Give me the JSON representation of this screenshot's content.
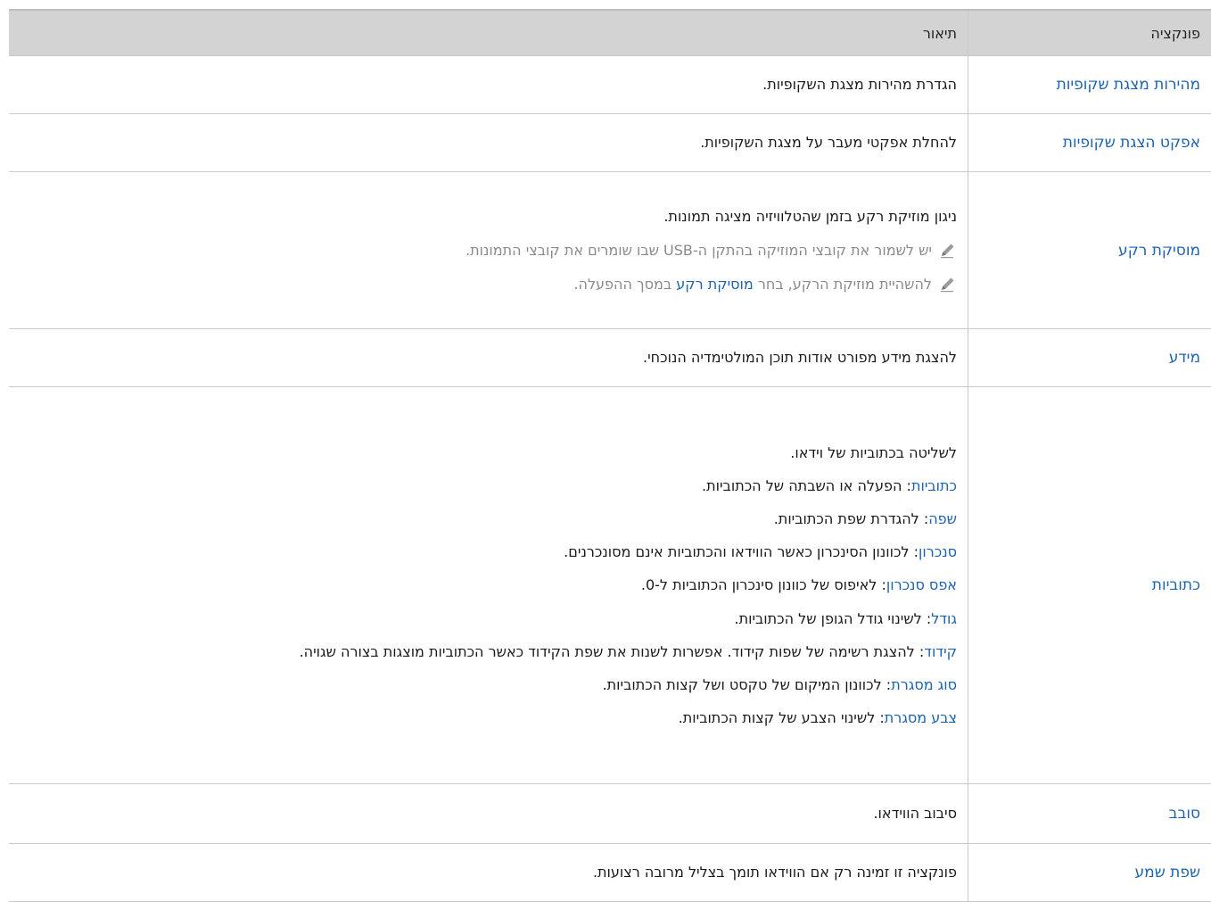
{
  "header": {
    "function_col": "פונקציה",
    "desc_col": "תיאור"
  },
  "rows": [
    {
      "func": "מהירות מצגת שקופיות",
      "desc": "הגדרת מהירות מצגת השקופיות."
    },
    {
      "func": "אפקט הצגת שקופיות",
      "desc": "להחלת אפקטי מעבר על מצגת השקופיות."
    },
    {
      "func": "מוסיקת רקע",
      "desc": "ניגון מוזיקת רקע בזמן שהטלוויזיה מציגה תמונות.",
      "note1": "יש לשמור את קובצי המוזיקה בהתקן ה-USB שבו שומרים את קובצי התמונות.",
      "note2_pre": "להשהיית מוזיקת הרקע, בחר ",
      "note2_link": "מוסיקת רקע",
      "note2_post": " במסך ההפעלה."
    },
    {
      "func": "מידע",
      "desc": "להצגת מידע מפורט אודות תוכן המולטימדיה הנוכחי."
    },
    {
      "func": "כתוביות",
      "intro": "לשליטה בכתוביות של וידאו.",
      "items": [
        {
          "term": "כתוביות",
          "text": ": הפעלה או השבתה של הכתוביות."
        },
        {
          "term": "שפה",
          "text": ": להגדרת שפת הכתוביות."
        },
        {
          "term": "סנכרון",
          "text": ": לכוונון הסינכרון כאשר הווידאו והכתוביות אינם מסונכרנים."
        },
        {
          "term": "אפס סנכרון",
          "text": ": לאיפוס של כוונון סינכרון הכתוביות ל-0."
        },
        {
          "term": "גודל",
          "text": ": לשינוי גודל הגופן של הכתוביות."
        },
        {
          "term": "קידוד",
          "text": ": להצגת רשימה של שפות קידוד. אפשרות לשנות את שפת הקידוד כאשר הכתוביות מוצגות בצורה שגויה."
        },
        {
          "term": "סוג מסגרת",
          "text": ": לכוונון המיקום של טקסט ושל קצות הכתוביות."
        },
        {
          "term": "צבע מסגרת",
          "text": ": לשינוי הצבע של קצות הכתוביות."
        }
      ]
    },
    {
      "func": "סובב",
      "desc": "סיבוב הווידאו."
    },
    {
      "func": "שפת שמע",
      "desc": "פונקציה זו זמינה רק אם הווידאו תומך בצליל מרובה רצועות."
    }
  ],
  "colors": {
    "link": "#1b63b0",
    "header_bg": "#d3d3d3",
    "note": "#8a8a8a"
  },
  "icons": {
    "note_icon": "pencil-icon"
  }
}
